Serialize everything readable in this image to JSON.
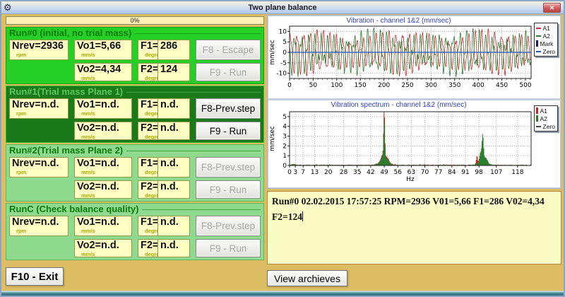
{
  "window": {
    "title": "Two plane balance",
    "close_glyph": "✕"
  },
  "progress": {
    "label": "0%"
  },
  "sections": [
    {
      "style": "bright",
      "title": "Run#0 (initial, no trial mass)",
      "nrev": "Nrev=2936",
      "nrev_unit": "rpm",
      "vo1": "Vo1=5,66",
      "vo1_unit": "mm/s",
      "f1_label": "F1=",
      "f1_unit": "degree",
      "f1_value": "286",
      "vo2": "Vo2=4,34",
      "vo2_unit": "mm/s",
      "f2_label": "F2=",
      "f2_unit": "degree",
      "f2_value": "124",
      "btn1": {
        "label": "F8 - Escape",
        "enabled": false
      },
      "btn2": {
        "label": "F9 - Run",
        "enabled": false
      }
    },
    {
      "style": "dark",
      "title": "Run#1(Trial mass Plane 1)",
      "nrev": "Nrev=n.d.",
      "nrev_unit": "rpm",
      "vo1": "Vo1=n.d.",
      "vo1_unit": "mm/s",
      "f1_label": "F1=",
      "f1_unit": "degree",
      "f1_value": "n.d.",
      "vo2": "Vo2=n.d.",
      "vo2_unit": "mm/s",
      "f2_label": "F2=",
      "f2_unit": "degree",
      "f2_value": "n.d.",
      "btn1": {
        "label": "F8-Prev.step",
        "enabled": true
      },
      "btn2": {
        "label": "F9 - Run",
        "enabled": true
      }
    },
    {
      "style": "pale",
      "title": "Run#2(Trial mass Plane 2)",
      "nrev": "Nrev=n.d.",
      "nrev_unit": "rpm",
      "vo1": "Vo1=n.d.",
      "vo1_unit": "mm/s",
      "f1_label": "F1=",
      "f1_unit": "degree",
      "f1_value": "n.d.",
      "vo2": "Vo2=n.d.",
      "vo2_unit": "mm/s",
      "f2_label": "F2=",
      "f2_unit": "degree",
      "f2_value": "n.d.",
      "btn1": {
        "label": "F8-Prev.step",
        "enabled": false
      },
      "btn2": {
        "label": "F9 - Run",
        "enabled": false
      }
    },
    {
      "style": "pale",
      "title": "RunC (Check balance quality)",
      "nrev": "Nrev=n.d.",
      "nrev_unit": "rpm",
      "vo1": "Vo1=n.d.",
      "vo1_unit": "mm/s",
      "f1_label": "F1=",
      "f1_unit": "degree",
      "f1_value": "n.d.",
      "vo2": "Vo2=n.d.",
      "vo2_unit": "mm/s",
      "f2_label": "F2=",
      "f2_unit": "degree",
      "f2_value": "n.d.",
      "btn1": {
        "label": "F8-Prev.step",
        "enabled": false
      },
      "btn2": {
        "label": "F9 - Run",
        "enabled": false
      }
    }
  ],
  "exit_button_label": "F10 - Exit",
  "archive_button_label": "View archieves",
  "log": {
    "text": "Run#0 02.02.2015 17:57:25 RPM=2936 V01=5,66 F1=286 V02=4,34 F2=124"
  },
  "chart_data": [
    {
      "type": "line",
      "title": "Vibration - channel 1&2 (mm/sec)",
      "xlabel": "",
      "ylabel": "mm/sec",
      "xlim": [
        0,
        512
      ],
      "ylim": [
        -12.5,
        12.5
      ],
      "xticks": [
        0,
        50,
        100,
        150,
        200,
        250,
        300,
        350,
        400,
        450,
        500
      ],
      "yticks": [
        10,
        5,
        0,
        -5,
        -10
      ],
      "grid": true,
      "legend_position": "right-outside",
      "legend": [
        {
          "name": "A1",
          "color": "#C43333",
          "swatch": "dash"
        },
        {
          "name": "A2",
          "color": "#2E7D2E",
          "swatch": "dash"
        },
        {
          "name": "Mark",
          "color": "#1A1A78",
          "swatch": "bar"
        },
        {
          "name": "Zero",
          "color": "#2255CC",
          "swatch": "dash"
        }
      ],
      "zero_line": {
        "y": 0,
        "color": "#2255CC"
      },
      "samples": 512,
      "series": [
        {
          "name": "A1",
          "color": "#C43333",
          "amplitude": 9.6,
          "cycles": 36.6,
          "harm2": 0.22,
          "phase": 0.7
        },
        {
          "name": "A2",
          "color": "#2E7D2E",
          "amplitude": 8.4,
          "cycles": 36.6,
          "harm2": 0.45,
          "phase": 2.9
        }
      ]
    },
    {
      "type": "bar",
      "title": "Vibration spectrum - channel 1&2 (mm/sec)",
      "xlabel": "Hz",
      "ylabel": "mm/sec",
      "xlim": [
        0,
        125
      ],
      "ylim": [
        0,
        5.5
      ],
      "xticks": [
        0,
        3,
        7,
        13,
        20,
        28,
        35,
        42,
        49,
        56,
        63,
        70,
        77,
        84,
        91,
        98,
        107,
        118
      ],
      "yticks": [
        0,
        1,
        2,
        3,
        4,
        5
      ],
      "grid": true,
      "legend_position": "right-outside",
      "legend": [
        {
          "name": "A1",
          "color": "#CC2222",
          "swatch": "bar"
        },
        {
          "name": "A2",
          "color": "#2E7D2E",
          "swatch": "bar"
        },
        {
          "name": "Zero",
          "color": "#444444",
          "swatch": "dash"
        }
      ],
      "main_peaks_hz": {
        "A1": [
          [
            49,
            5.05
          ],
          [
            97,
            0.8
          ]
        ],
        "A2": [
          [
            49,
            4.35
          ],
          [
            100,
            2.45
          ]
        ]
      },
      "series": [
        {
          "name": "A1",
          "color": "#CC2222",
          "noise": 0.05,
          "peaks": [
            [
              49,
              5.05,
              0.45
            ],
            [
              48,
              0.55,
              1.0
            ],
            [
              50.5,
              0.4,
              1.2
            ],
            [
              49,
              0.5,
              3.2
            ],
            [
              97,
              0.8,
              0.5
            ],
            [
              99,
              0.25,
              2.5
            ],
            [
              2,
              0.1,
              1.2
            ]
          ]
        },
        {
          "name": "A2",
          "color": "#2E7D2E",
          "noise": 0.05,
          "peaks": [
            [
              49,
              4.35,
              0.45
            ],
            [
              48,
              0.45,
              1.0
            ],
            [
              50.5,
              0.35,
              1.2
            ],
            [
              49,
              0.4,
              3.0
            ],
            [
              100,
              2.45,
              0.55
            ],
            [
              99,
              1.0,
              0.9
            ],
            [
              101.5,
              0.5,
              1.2
            ],
            [
              100,
              0.35,
              3.0
            ],
            [
              2,
              0.08,
              1.2
            ]
          ]
        }
      ]
    }
  ],
  "colors": {
    "section_bright": "#25CF25",
    "section_dark": "#1A7A1A",
    "section_pale": "#8EDA8E",
    "field_bg": "#FFFFC4",
    "window_bg": "#DDBD64",
    "chart_area_bg": "#C5CFE0",
    "a1": "#C43333",
    "a2": "#2E7D2E",
    "zero": "#2255CC",
    "mark": "#1A1A78"
  }
}
